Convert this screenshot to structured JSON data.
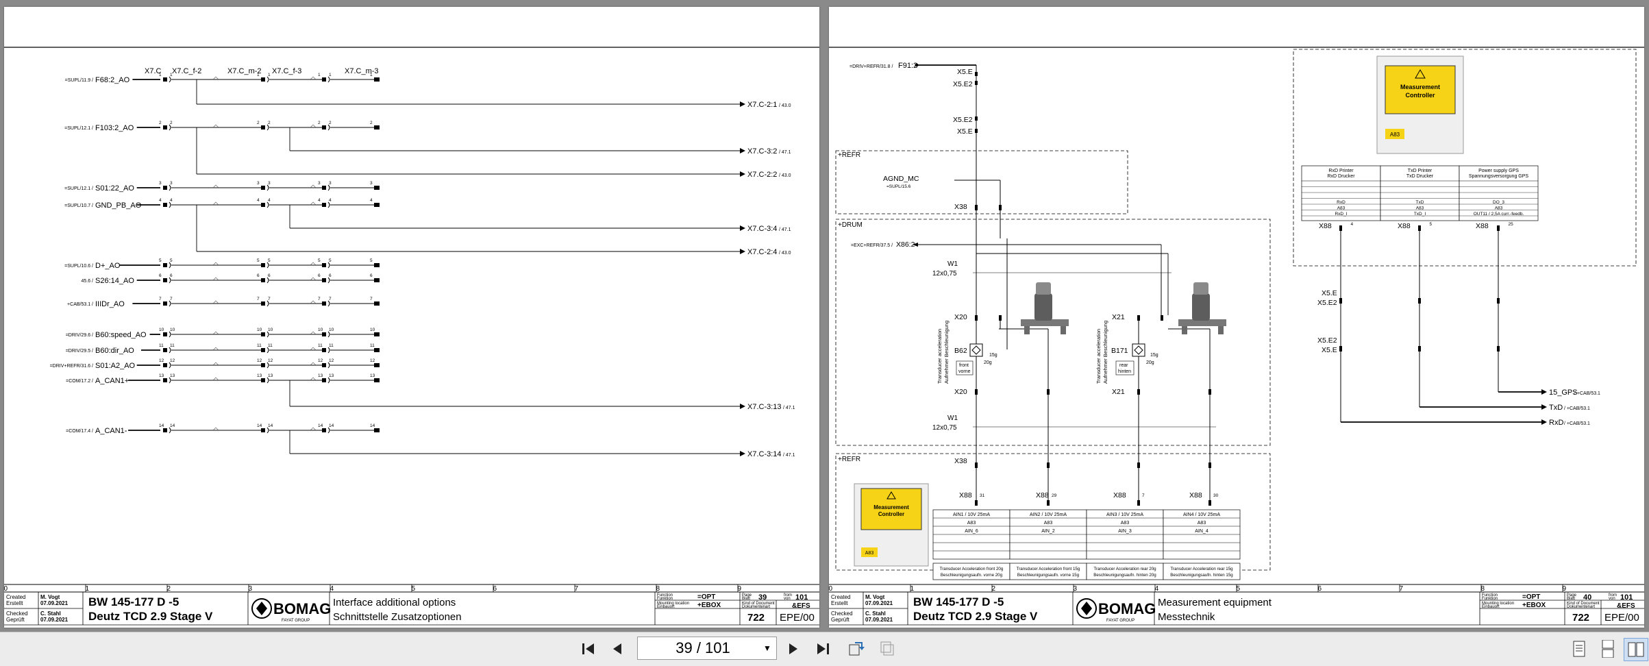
{
  "left_page": {
    "conn_headers": [
      "X7.C",
      "X7.C_f-2",
      "X7.C_m-2",
      "X7.C_f-3",
      "X7.C_m-3"
    ],
    "rows": [
      {
        "ref": "=SUPL/11.9 /",
        "sig": "F68:2_AO",
        "pin": "1"
      },
      {
        "ref": "=SUPL/12.1 /",
        "sig": "F103:2_AO",
        "pin": "2"
      },
      {
        "ref": "=SUPL/12.1 /",
        "sig": "S01:22_AO",
        "pin": "3"
      },
      {
        "ref": "=SUPL/10.7 /",
        "sig": "GND_PB_AO",
        "pin": "4"
      },
      {
        "ref": "=SUPL/10.6 /",
        "sig": "D+_AO",
        "pin": "5"
      },
      {
        "ref": "45.6 /",
        "sig": "S26:14_AO",
        "pin": "6"
      },
      {
        "ref": "+CAB/53.1 /",
        "sig": "IIIDr_AO",
        "pin": "7"
      },
      {
        "ref": "=DRIV/29.6 /",
        "sig": "B60:speed_AO",
        "pin": "10"
      },
      {
        "ref": "=DRIV/29.5 /",
        "sig": "B60:dir_AO",
        "pin": "11"
      },
      {
        "ref": "=DRIV+REFR/31.6 /",
        "sig": "S01:A2_AO",
        "pin": "12"
      },
      {
        "ref": "=COM/17.2 /",
        "sig": "A_CAN1+",
        "pin": "13"
      },
      {
        "ref": "=COM/17.4 /",
        "sig": "A_CAN1-",
        "pin": "14"
      }
    ],
    "targets": [
      {
        "label": "X7.C-2:1",
        "ref": "/ 43.0"
      },
      {
        "label": "X7.C-3:2",
        "ref": "/ 47.1"
      },
      {
        "label": "X7.C-2:2",
        "ref": "/ 43.0"
      },
      {
        "label": "X7.C-3:4",
        "ref": "/ 47.1"
      },
      {
        "label": "X7.C-2:4",
        "ref": "/ 43.0"
      },
      {
        "label": "X7.C-3:13",
        "ref": "/ 47.1"
      },
      {
        "label": "X7.C-3:14",
        "ref": "/ 47.1"
      }
    ],
    "columns": [
      "0",
      "1",
      "2",
      "3",
      "4",
      "5",
      "6",
      "7",
      "8",
      "9"
    ],
    "title_block": {
      "created_label": "Created",
      "created_label2": "Erstellt",
      "created_by": "M. Vogt",
      "created_date": "07.09.2021",
      "checked_label": "Checked",
      "checked_label2": "Geprüft",
      "checked_by": "C. Stahl",
      "checked_date": "07.09.2021",
      "model": "BW 145-177 D -5",
      "engine": "Deutz TCD 2.9 Stage V",
      "brand": "BOMAG",
      "brand_sub": "FAYAT GROUP",
      "desc_en": "Interface additional options",
      "desc_de": "Schnittstelle Zusatzoptionen",
      "function_label": "Function",
      "function_label2": "Funktion",
      "function_value": "=OPT",
      "mount_label": "Mounting location",
      "mount_label2": "Einbauort",
      "mount_value": "+EBOX",
      "kind_label": "Kind of Document",
      "kind_label2": "Dokumentenart",
      "kind_value": "&EFS",
      "page_label": "Page",
      "page_label2": "Blatt",
      "page": "39",
      "from_label": "from",
      "from_label2": "von",
      "total": "101",
      "docno": "722",
      "docver": "EPE/00"
    }
  },
  "right_page": {
    "f91": {
      "ref": "=DRIV+REFR/31.8 /",
      "sig": "F91:2"
    },
    "x5_labels": [
      "X5.E",
      "X5.E2",
      "X5.E2",
      "X5.E"
    ],
    "refr_label": "+REFR",
    "drum_label": "+DRUM",
    "refr_label2": "+REFR",
    "agnd": {
      "sig": "AGND_MC",
      "ref": "=SUPL/15.6"
    },
    "x86": {
      "ref": "=EXC+REFR/37.5 /",
      "sig": "X86:2"
    },
    "x38": "X38",
    "w1": "W1",
    "cable": "12x0,75",
    "x20": "X20",
    "x21": "X21",
    "b62": "B62",
    "b171": "B171",
    "range20g": "20g",
    "range15g": "15g",
    "front": "front",
    "front_de": "vorne",
    "rear": "rear",
    "rear_de": "hinten",
    "transducer": "Transducer acceleration",
    "transducer_de": "Aufnehmer Beschleunigung",
    "x88": "X88",
    "mc_title": "Measurement",
    "mc_title2": "Controller",
    "mc_tag": "A83",
    "aux_table": {
      "headers": [
        [
          "RxD Printer",
          "RxD Drucker"
        ],
        [
          "TxD Printer",
          "TxD Drucker"
        ],
        [
          "Power supply GPS",
          "Spannungsversorgung GPS"
        ]
      ],
      "rows": [
        [
          "RxD",
          "TxD",
          "DO_3"
        ],
        [
          "A83",
          "A83",
          "A83"
        ],
        [
          "RxD_I",
          "TxD_I",
          "OUT11 / 2,5A curr.-feedb."
        ]
      ],
      "x88_pins": [
        "4",
        "5",
        "25"
      ]
    },
    "ain_table": {
      "headers": [
        "AIN1 / 10V 25mA",
        "AIN2 / 10V 25mA",
        "AIN3 / 10V 25mA",
        "AIN4 / 10V 25mA"
      ],
      "row2": [
        "A83",
        "A83",
        "A83",
        "A83"
      ],
      "row3": [
        "AIN_6",
        "AIN_2",
        "AIN_3",
        "AIN_4"
      ],
      "desc": [
        [
          "Transducer Acceleration front 20g",
          "Beschleunigungsaufn. vorne 20g"
        ],
        [
          "Transducer Acceleration front 15g",
          "Beschleunigungsaufn. vorne 15g"
        ],
        [
          "Transducer Acceleration rear 20g",
          "Beschleunigungsaufn. hinten 20g"
        ],
        [
          "Transducer Acceleration rear 15g",
          "Beschleunigungsaufn. hinten 15g"
        ]
      ],
      "x88_pins": [
        "31",
        "29",
        "7",
        "30"
      ]
    },
    "outputs": [
      {
        "sig": "15_GPS",
        "ref": "/ +CAB/53.1"
      },
      {
        "sig": "TxD",
        "ref": "/ +CAB/53.1"
      },
      {
        "sig": "RxD",
        "ref": "/ +CAB/53.1"
      }
    ],
    "columns": [
      "0",
      "1",
      "2",
      "3",
      "4",
      "5",
      "6",
      "7",
      "8",
      "9"
    ],
    "title_block": {
      "created_label": "Created",
      "created_label2": "Erstellt",
      "created_by": "M. Vogt",
      "created_date": "07.09.2021",
      "checked_label": "Checked",
      "checked_label2": "Geprüft",
      "checked_by": "C. Stahl",
      "checked_date": "07.09.2021",
      "model": "BW 145-177 D -5",
      "engine": "Deutz TCD 2.9 Stage V",
      "brand": "BOMAG",
      "brand_sub": "FAYAT GROUP",
      "desc_en": "Measurement equipment",
      "desc_de": "Messtechnik",
      "function_label": "Function",
      "function_label2": "Funktion",
      "function_value": "=OPT",
      "mount_label": "Mounting location",
      "mount_label2": "Einbauort",
      "mount_value": "+EBOX",
      "kind_label": "Kind of Document",
      "kind_label2": "Dokumentenart",
      "kind_value": "&EFS",
      "page_label": "Page",
      "page_label2": "Blatt",
      "page": "40",
      "from_label": "from",
      "from_label2": "von",
      "total": "101",
      "docno": "722",
      "docver": "EPE/00"
    }
  },
  "toolbar": {
    "page_display": "39 / 101",
    "icons": [
      "first-page-icon",
      "prev-page-icon",
      "next-page-icon",
      "last-page-icon",
      "back-history-icon",
      "forward-history-icon",
      "single-page-view-icon",
      "continuous-view-icon",
      "two-page-view-icon"
    ]
  }
}
